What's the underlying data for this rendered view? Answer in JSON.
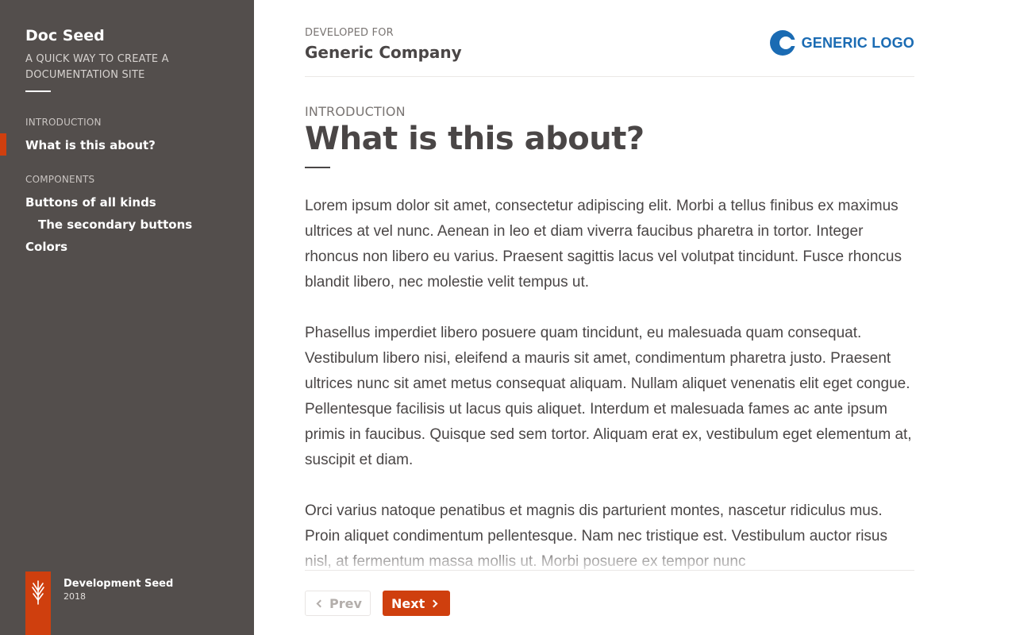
{
  "sidebar": {
    "title": "Doc Seed",
    "tagline": "A QUICK WAY TO CREATE A DOCUMENTATION SITE",
    "sections": [
      {
        "label": "INTRODUCTION",
        "items": [
          {
            "label": "What is this about?",
            "active": true
          }
        ]
      },
      {
        "label": "COMPONENTS",
        "items": [
          {
            "label": "Buttons of all kinds"
          },
          {
            "label": "The secondary buttons",
            "level": 2
          },
          {
            "label": "Colors"
          }
        ]
      }
    ],
    "footer": {
      "name": "Development Seed",
      "year": "2018"
    }
  },
  "header": {
    "developed_for_label": "DEVELOPED FOR",
    "company": "Generic Company",
    "logo_text": "GENERIC LOGO"
  },
  "main": {
    "kicker": "INTRODUCTION",
    "title": "What is this about?",
    "paragraphs": [
      "Lorem ipsum dolor sit amet, consectetur adipiscing elit. Morbi a tellus finibus ex maximus ultrices at vel nunc. Aenean in leo et diam viverra faucibus pharetra in tortor. Integer rhoncus non libero eu varius. Praesent sagittis lacus vel volutpat tincidunt. Fusce rhoncus blandit libero, nec molestie velit tempus ut.",
      "Phasellus imperdiet libero posuere quam tincidunt, eu malesuada quam consequat. Vestibulum libero nisi, eleifend a mauris sit amet, condimentum pharetra justo. Praesent ultrices nunc sit amet metus consequat aliquam. Nullam aliquet venenatis elit eget congue. Pellentesque facilisis ut lacus quis aliquet. Interdum et malesuada fames ac ante ipsum primis in faucibus. Quisque sed sem tortor. Aliquam erat ex, vestibulum eget elementum at, suscipit et diam.",
      "Orci varius natoque penatibus et magnis dis parturient montes, nascetur ridiculus mus. Proin aliquet condimentum pellentesque. Nam nec tristique est. Vestibulum auctor risus nisl, at fermentum massa mollis ut. Morbi posuere ex tempor nunc"
    ]
  },
  "pagination": {
    "prev_label": "Prev",
    "next_label": "Next"
  },
  "colors": {
    "sidebar_bg": "#534e4c",
    "accent": "#cf3f0e",
    "logo_blue": "#1a6bb3",
    "text": "#4a4646"
  },
  "icons": {
    "footer_logo": "wheat-icon",
    "brand_logo": "generic-logo-icon",
    "prev": "chevron-left-icon",
    "next": "chevron-right-icon"
  }
}
